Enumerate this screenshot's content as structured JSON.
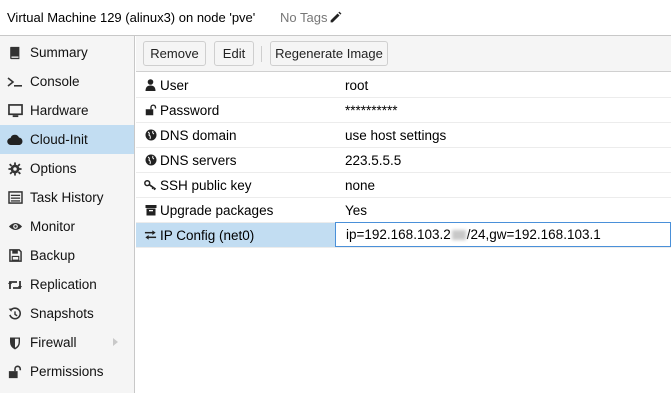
{
  "header": {
    "title": "Virtual Machine 129 (alinux3) on node 'pve'",
    "tags_label": "No Tags"
  },
  "sidebar": {
    "items": [
      {
        "label": "Summary",
        "icon": "book-icon"
      },
      {
        "label": "Console",
        "icon": "terminal-icon"
      },
      {
        "label": "Hardware",
        "icon": "monitor-icon"
      },
      {
        "label": "Cloud-Init",
        "icon": "cloud-icon",
        "active": true
      },
      {
        "label": "Options",
        "icon": "gear-icon"
      },
      {
        "label": "Task History",
        "icon": "list-icon"
      },
      {
        "label": "Monitor",
        "icon": "eye-icon"
      },
      {
        "label": "Backup",
        "icon": "floppy-icon"
      },
      {
        "label": "Replication",
        "icon": "retweet-icon"
      },
      {
        "label": "Snapshots",
        "icon": "history-icon"
      },
      {
        "label": "Firewall",
        "icon": "shield-icon"
      },
      {
        "label": "Permissions",
        "icon": "unlock-icon"
      }
    ]
  },
  "toolbar": {
    "remove_label": "Remove",
    "edit_label": "Edit",
    "regenerate_label": "Regenerate Image"
  },
  "grid": {
    "rows": [
      {
        "key": "User",
        "value": "root",
        "icon": "user-icon"
      },
      {
        "key": "Password",
        "value": "**********",
        "icon": "unlock-icon"
      },
      {
        "key": "DNS domain",
        "value": "use host settings",
        "icon": "globe-icon"
      },
      {
        "key": "DNS servers",
        "value": "223.5.5.5",
        "icon": "globe-icon"
      },
      {
        "key": "SSH public key",
        "value": "none",
        "icon": "key-icon"
      },
      {
        "key": "Upgrade packages",
        "value": "Yes",
        "icon": "archive-icon"
      },
      {
        "key": "IP Config (net0)",
        "value_prefix": "ip=192.168.103.2",
        "value_suffix": "/24,gw=192.168.103.1",
        "icon": "exchange-icon",
        "selected": true
      }
    ]
  },
  "colors": {
    "selection": "#c2ddf2",
    "sidebar_bg": "#f5f5f5",
    "accent_border": "#4a90d9"
  }
}
